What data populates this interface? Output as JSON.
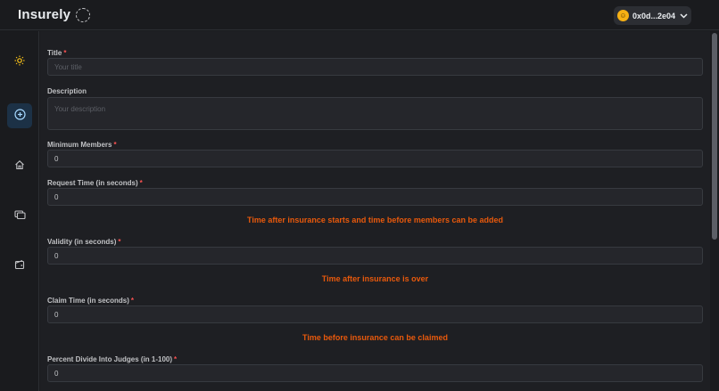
{
  "header": {
    "brand": "Insurely",
    "wallet_address": "0x0d...2e04"
  },
  "sidebar": {
    "items": [
      {
        "icon": "sun-icon",
        "name": "theme-toggle"
      },
      {
        "icon": "plus-circle-icon",
        "name": "create"
      },
      {
        "icon": "home-icon",
        "name": "home"
      },
      {
        "icon": "cards-icon",
        "name": "policies"
      },
      {
        "icon": "wallet-icon",
        "name": "wallet"
      }
    ]
  },
  "form": {
    "title": {
      "label": "Title",
      "placeholder": "Your title"
    },
    "description": {
      "label": "Description",
      "placeholder": "Your description"
    },
    "min_members": {
      "label": "Minimum Members",
      "value": "0"
    },
    "request_time": {
      "label": "Request Time (in seconds)",
      "value": "0",
      "hint": "Time after insurance starts and time before members can be added"
    },
    "validity": {
      "label": "Validity (in seconds)",
      "value": "0",
      "hint": "Time after insurance is over"
    },
    "claim_time": {
      "label": "Claim Time (in seconds)",
      "value": "0",
      "hint": "Time before insurance can be claimed"
    },
    "percent_judges": {
      "label": "Percent Divide Into Judges (in 1-100)",
      "value": "0"
    },
    "required_mark": "*"
  },
  "colors": {
    "accent": "#e8590c",
    "required": "#fa5252",
    "active_nav": "#1c3146"
  }
}
